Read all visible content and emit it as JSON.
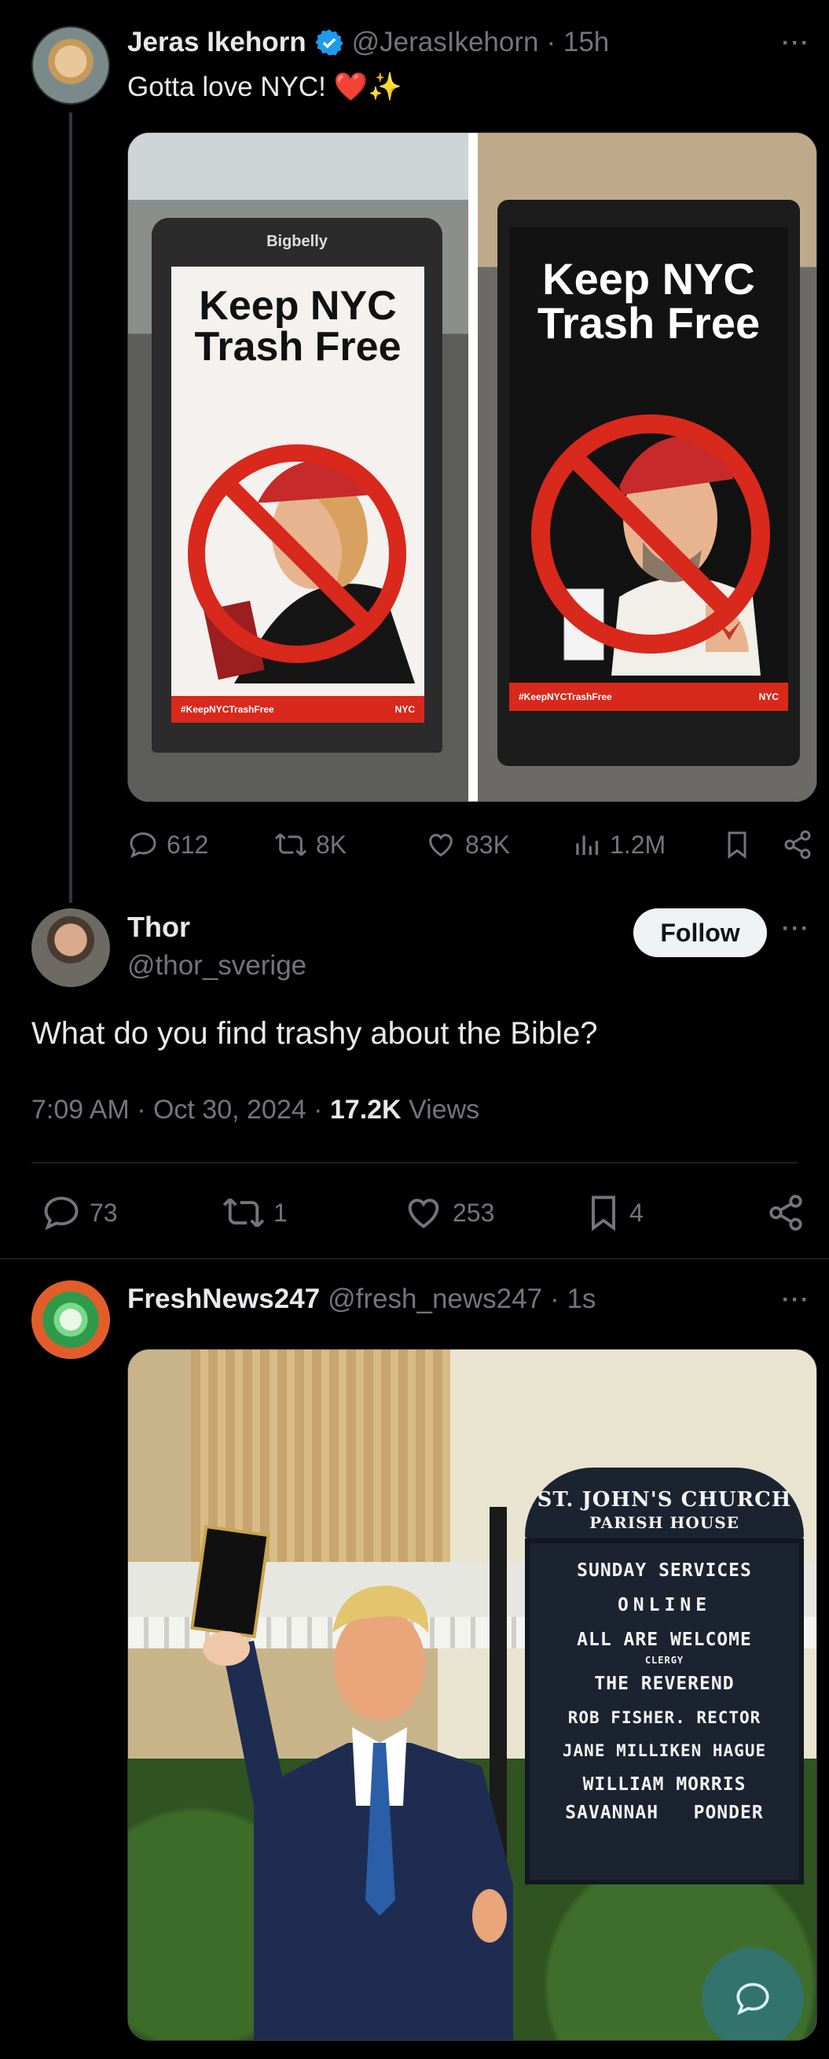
{
  "tweet1": {
    "name": "Jeras Ikehorn",
    "handle": "@JerasIkehorn",
    "time": "· 15h",
    "text": "Gotta love NYC! ❤️✨",
    "media_left": {
      "brand": "Bigbelly",
      "headline1": "Keep NYC",
      "headline2": "Trash Free",
      "hashtag": "#KeepNYCTrashFree",
      "logo": "NYC"
    },
    "media_right": {
      "headline1": "Keep NYC",
      "headline2": "Trash Free",
      "hashtag": "#KeepNYCTrashFree",
      "logo": "NYC"
    },
    "stats": {
      "replies": "612",
      "retweets": "8K",
      "likes": "83K",
      "views": "1.2M"
    }
  },
  "tweet2": {
    "name": "Thor",
    "handle": "@thor_sverige",
    "follow_label": "Follow",
    "text": "What do you find trashy about the Bible?",
    "timestamp": "7:09 AM · Oct 30, 2024 · ",
    "views_count": "17.2K",
    "views_label": " Views",
    "stats": {
      "replies": "73",
      "retweets": "1",
      "likes": "253",
      "bookmarks": "4"
    }
  },
  "tweet3": {
    "name": "FreshNews247",
    "handle": "@fresh_news247",
    "time": "· 1s",
    "sign": {
      "title": "ST. JOHN'S CHURCH",
      "subtitle": "PARISH HOUSE",
      "lines": [
        "SUNDAY SERVICES",
        "ONLINE",
        "ALL ARE WELCOME",
        "CLERGY",
        "THE REVEREND",
        "ROB FISHER. RECTOR",
        "JANE MILLIKEN HAGUE",
        "WILLIAM MORRIS",
        "SAVANNAH   PONDER"
      ]
    }
  },
  "colors": {
    "background": "#000000",
    "text": "#e7e9ea",
    "muted": "#71767b",
    "verified": "#1d9bf0",
    "divider": "#2f3336",
    "no_sign_red": "#d9281c",
    "maga_red": "#c62a2a"
  }
}
